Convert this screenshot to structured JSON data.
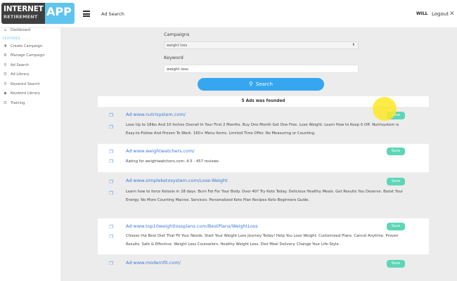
{
  "logo": {
    "line1": "INTERNET",
    "line2": "RETIREMENT",
    "app": "APP"
  },
  "header": {
    "title": "Ad Search",
    "user": "WILL",
    "logout": "Logout",
    "close_glyph": "✕"
  },
  "sidebar": {
    "section": "FEATURES",
    "items": [
      {
        "label": "Dashboard",
        "icon": "home-icon"
      },
      {
        "label": "Create Campaign",
        "icon": "plus-icon"
      },
      {
        "label": "Manage Campaign",
        "icon": "cogs-icon"
      },
      {
        "label": "Ad Search",
        "icon": "search-icon"
      },
      {
        "label": "Ad Library",
        "icon": "list-icon"
      },
      {
        "label": "Keyword Search",
        "icon": "search-icon"
      },
      {
        "label": "Keyword Library",
        "icon": "tag-icon"
      },
      {
        "label": "Training",
        "icon": "list-icon"
      }
    ]
  },
  "form": {
    "campaigns_label": "Campaigns",
    "campaign_value": "weight loss",
    "keyword_label": "Keyword",
    "keyword_value": "weight loss",
    "search_label": "Search"
  },
  "results": {
    "header": "5 Ads was founded",
    "save_label": "Save",
    "ads": [
      {
        "link": "Ad·www.nutrisystem.com/",
        "desc": "Lose Up to 18lbs And 10 Inches Overall In Your First 2 Months. Buy One Month Get One Free. Lose Weight. Learn How to Keep it Off. Nutrisystem is Easy-to-Follow And Proven To Work. 160+ Menu Items. Limited Time Offer. No Measuring or Counting."
      },
      {
        "link": "Ad·www.weightwatchers.com/",
        "desc": "Rating for weightwatchers.com: 4.5 - 457 reviews"
      },
      {
        "link": "Ad·www.simpleketosystem.com/Lose-Weight",
        "desc": "Learn how to force Ketosis in 28 days. Burn Fat For Your Body. Over 40? Try Keto Today. Delicious Healthy Meals. Get Results You Deserve. Boost Your Energy. No More Counting Macros. Services: Personalized Keto Plan Recipes Keto Beginners Guide."
      },
      {
        "link": "Ad·www.top10weightlossplans.com/BestPlans/WeightLoss",
        "desc": "Choose the Best Diet That Fit Your Needs. Start Your Weight Loss Journey Today! Help You Lose Weight. Customized Plans. Cancel Anytime. Proven Results. Safe & Effective. Weight Loss Counselors. Healthy Weight Loss. Diet Meal Delivery. Change Your Life-Style."
      },
      {
        "link": "Ad·www.modernfit.com/",
        "desc": ""
      }
    ]
  },
  "colors": {
    "accent": "#36a6f0",
    "save": "#5cd6b6",
    "link": "#3a7ad8",
    "logo_blue": "#5fc4ee"
  }
}
